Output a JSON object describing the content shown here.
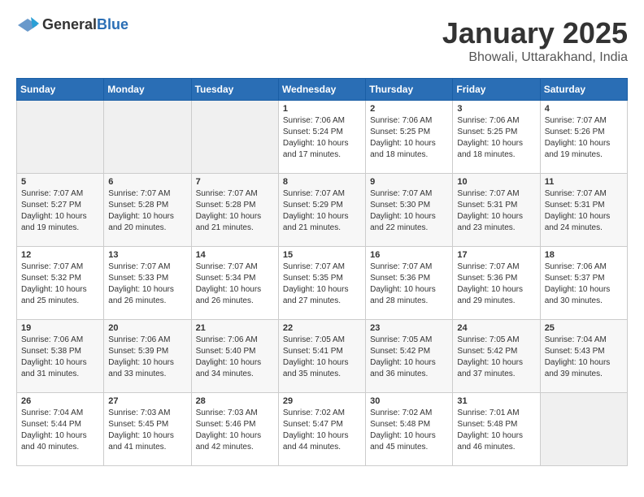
{
  "logo": {
    "text_general": "General",
    "text_blue": "Blue"
  },
  "header": {
    "title": "January 2025",
    "subtitle": "Bhowali, Uttarakhand, India"
  },
  "weekdays": [
    "Sunday",
    "Monday",
    "Tuesday",
    "Wednesday",
    "Thursday",
    "Friday",
    "Saturday"
  ],
  "weeks": [
    [
      {
        "day": "",
        "empty": true
      },
      {
        "day": "",
        "empty": true
      },
      {
        "day": "",
        "empty": true
      },
      {
        "day": "1",
        "sunrise": "Sunrise: 7:06 AM",
        "sunset": "Sunset: 5:24 PM",
        "daylight": "Daylight: 10 hours and 17 minutes."
      },
      {
        "day": "2",
        "sunrise": "Sunrise: 7:06 AM",
        "sunset": "Sunset: 5:25 PM",
        "daylight": "Daylight: 10 hours and 18 minutes."
      },
      {
        "day": "3",
        "sunrise": "Sunrise: 7:06 AM",
        "sunset": "Sunset: 5:25 PM",
        "daylight": "Daylight: 10 hours and 18 minutes."
      },
      {
        "day": "4",
        "sunrise": "Sunrise: 7:07 AM",
        "sunset": "Sunset: 5:26 PM",
        "daylight": "Daylight: 10 hours and 19 minutes."
      }
    ],
    [
      {
        "day": "5",
        "sunrise": "Sunrise: 7:07 AM",
        "sunset": "Sunset: 5:27 PM",
        "daylight": "Daylight: 10 hours and 19 minutes."
      },
      {
        "day": "6",
        "sunrise": "Sunrise: 7:07 AM",
        "sunset": "Sunset: 5:28 PM",
        "daylight": "Daylight: 10 hours and 20 minutes."
      },
      {
        "day": "7",
        "sunrise": "Sunrise: 7:07 AM",
        "sunset": "Sunset: 5:28 PM",
        "daylight": "Daylight: 10 hours and 21 minutes."
      },
      {
        "day": "8",
        "sunrise": "Sunrise: 7:07 AM",
        "sunset": "Sunset: 5:29 PM",
        "daylight": "Daylight: 10 hours and 21 minutes."
      },
      {
        "day": "9",
        "sunrise": "Sunrise: 7:07 AM",
        "sunset": "Sunset: 5:30 PM",
        "daylight": "Daylight: 10 hours and 22 minutes."
      },
      {
        "day": "10",
        "sunrise": "Sunrise: 7:07 AM",
        "sunset": "Sunset: 5:31 PM",
        "daylight": "Daylight: 10 hours and 23 minutes."
      },
      {
        "day": "11",
        "sunrise": "Sunrise: 7:07 AM",
        "sunset": "Sunset: 5:31 PM",
        "daylight": "Daylight: 10 hours and 24 minutes."
      }
    ],
    [
      {
        "day": "12",
        "sunrise": "Sunrise: 7:07 AM",
        "sunset": "Sunset: 5:32 PM",
        "daylight": "Daylight: 10 hours and 25 minutes."
      },
      {
        "day": "13",
        "sunrise": "Sunrise: 7:07 AM",
        "sunset": "Sunset: 5:33 PM",
        "daylight": "Daylight: 10 hours and 26 minutes."
      },
      {
        "day": "14",
        "sunrise": "Sunrise: 7:07 AM",
        "sunset": "Sunset: 5:34 PM",
        "daylight": "Daylight: 10 hours and 26 minutes."
      },
      {
        "day": "15",
        "sunrise": "Sunrise: 7:07 AM",
        "sunset": "Sunset: 5:35 PM",
        "daylight": "Daylight: 10 hours and 27 minutes."
      },
      {
        "day": "16",
        "sunrise": "Sunrise: 7:07 AM",
        "sunset": "Sunset: 5:36 PM",
        "daylight": "Daylight: 10 hours and 28 minutes."
      },
      {
        "day": "17",
        "sunrise": "Sunrise: 7:07 AM",
        "sunset": "Sunset: 5:36 PM",
        "daylight": "Daylight: 10 hours and 29 minutes."
      },
      {
        "day": "18",
        "sunrise": "Sunrise: 7:06 AM",
        "sunset": "Sunset: 5:37 PM",
        "daylight": "Daylight: 10 hours and 30 minutes."
      }
    ],
    [
      {
        "day": "19",
        "sunrise": "Sunrise: 7:06 AM",
        "sunset": "Sunset: 5:38 PM",
        "daylight": "Daylight: 10 hours and 31 minutes."
      },
      {
        "day": "20",
        "sunrise": "Sunrise: 7:06 AM",
        "sunset": "Sunset: 5:39 PM",
        "daylight": "Daylight: 10 hours and 33 minutes."
      },
      {
        "day": "21",
        "sunrise": "Sunrise: 7:06 AM",
        "sunset": "Sunset: 5:40 PM",
        "daylight": "Daylight: 10 hours and 34 minutes."
      },
      {
        "day": "22",
        "sunrise": "Sunrise: 7:05 AM",
        "sunset": "Sunset: 5:41 PM",
        "daylight": "Daylight: 10 hours and 35 minutes."
      },
      {
        "day": "23",
        "sunrise": "Sunrise: 7:05 AM",
        "sunset": "Sunset: 5:42 PM",
        "daylight": "Daylight: 10 hours and 36 minutes."
      },
      {
        "day": "24",
        "sunrise": "Sunrise: 7:05 AM",
        "sunset": "Sunset: 5:42 PM",
        "daylight": "Daylight: 10 hours and 37 minutes."
      },
      {
        "day": "25",
        "sunrise": "Sunrise: 7:04 AM",
        "sunset": "Sunset: 5:43 PM",
        "daylight": "Daylight: 10 hours and 39 minutes."
      }
    ],
    [
      {
        "day": "26",
        "sunrise": "Sunrise: 7:04 AM",
        "sunset": "Sunset: 5:44 PM",
        "daylight": "Daylight: 10 hours and 40 minutes."
      },
      {
        "day": "27",
        "sunrise": "Sunrise: 7:03 AM",
        "sunset": "Sunset: 5:45 PM",
        "daylight": "Daylight: 10 hours and 41 minutes."
      },
      {
        "day": "28",
        "sunrise": "Sunrise: 7:03 AM",
        "sunset": "Sunset: 5:46 PM",
        "daylight": "Daylight: 10 hours and 42 minutes."
      },
      {
        "day": "29",
        "sunrise": "Sunrise: 7:02 AM",
        "sunset": "Sunset: 5:47 PM",
        "daylight": "Daylight: 10 hours and 44 minutes."
      },
      {
        "day": "30",
        "sunrise": "Sunrise: 7:02 AM",
        "sunset": "Sunset: 5:48 PM",
        "daylight": "Daylight: 10 hours and 45 minutes."
      },
      {
        "day": "31",
        "sunrise": "Sunrise: 7:01 AM",
        "sunset": "Sunset: 5:48 PM",
        "daylight": "Daylight: 10 hours and 46 minutes."
      },
      {
        "day": "",
        "empty": true
      }
    ]
  ]
}
